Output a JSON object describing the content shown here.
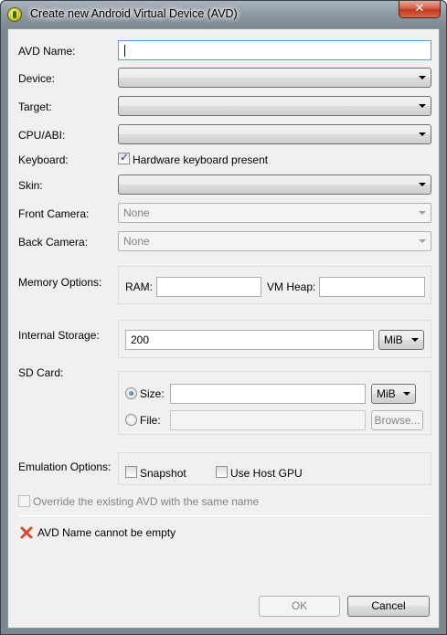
{
  "window": {
    "title": "Create new Android Virtual Device (AVD)",
    "close_glyph": "✕"
  },
  "form": {
    "avd_name_label": "AVD Name:",
    "avd_name_value": "",
    "device_label": "Device:",
    "device_value": "",
    "target_label": "Target:",
    "target_value": "",
    "cpu_label": "CPU/ABI:",
    "cpu_value": "",
    "keyboard_label": "Keyboard:",
    "keyboard_checkbox_label": "Hardware keyboard present",
    "keyboard_checked": true,
    "skin_label": "Skin:",
    "skin_value": "",
    "front_camera_label": "Front Camera:",
    "front_camera_value": "None",
    "back_camera_label": "Back Camera:",
    "back_camera_value": "None"
  },
  "memory": {
    "label": "Memory Options:",
    "ram_label": "RAM:",
    "ram_value": "",
    "vm_heap_label": "VM Heap:",
    "vm_heap_value": ""
  },
  "storage": {
    "label": "Internal Storage:",
    "value": "200",
    "unit": "MiB"
  },
  "sdcard": {
    "label": "SD Card:",
    "size_label": "Size:",
    "size_value": "",
    "size_unit": "MiB",
    "size_selected": true,
    "file_label": "File:",
    "file_value": "",
    "browse_label": "Browse..."
  },
  "emulation": {
    "label": "Emulation Options:",
    "snapshot_label": "Snapshot",
    "host_gpu_label": "Use Host GPU"
  },
  "override_label": "Override the existing AVD with the same name",
  "error_message": "AVD Name cannot be empty",
  "buttons": {
    "ok": "OK",
    "cancel": "Cancel"
  },
  "colors": {
    "error": "#d9492e",
    "focus_border": "#569de5",
    "title_bar": "#8a959d"
  }
}
